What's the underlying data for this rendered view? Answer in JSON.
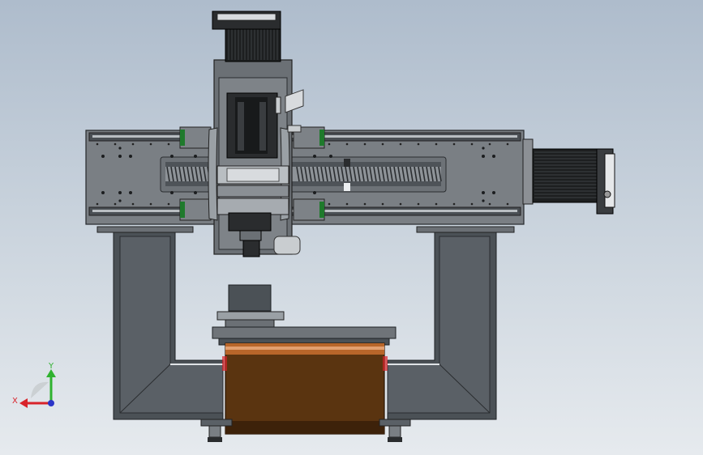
{
  "view": {
    "background_top": "#aebccc",
    "background_bottom": "#e6eaee"
  },
  "triad": {
    "x_label": "X",
    "y_label": "Y",
    "x_color": "#d8232a",
    "y_color": "#2fb22f",
    "z_color": "#2a34c8"
  },
  "colors": {
    "frame_dark": "#4b5156",
    "plate_gray": "#7a7f84",
    "steel_light": "#c9cdd0",
    "motor_black": "#1d1f20",
    "rail_green": "#1f7a2c",
    "workpiece": "#5a3410",
    "workpiece_edge": "#d48a4a"
  }
}
